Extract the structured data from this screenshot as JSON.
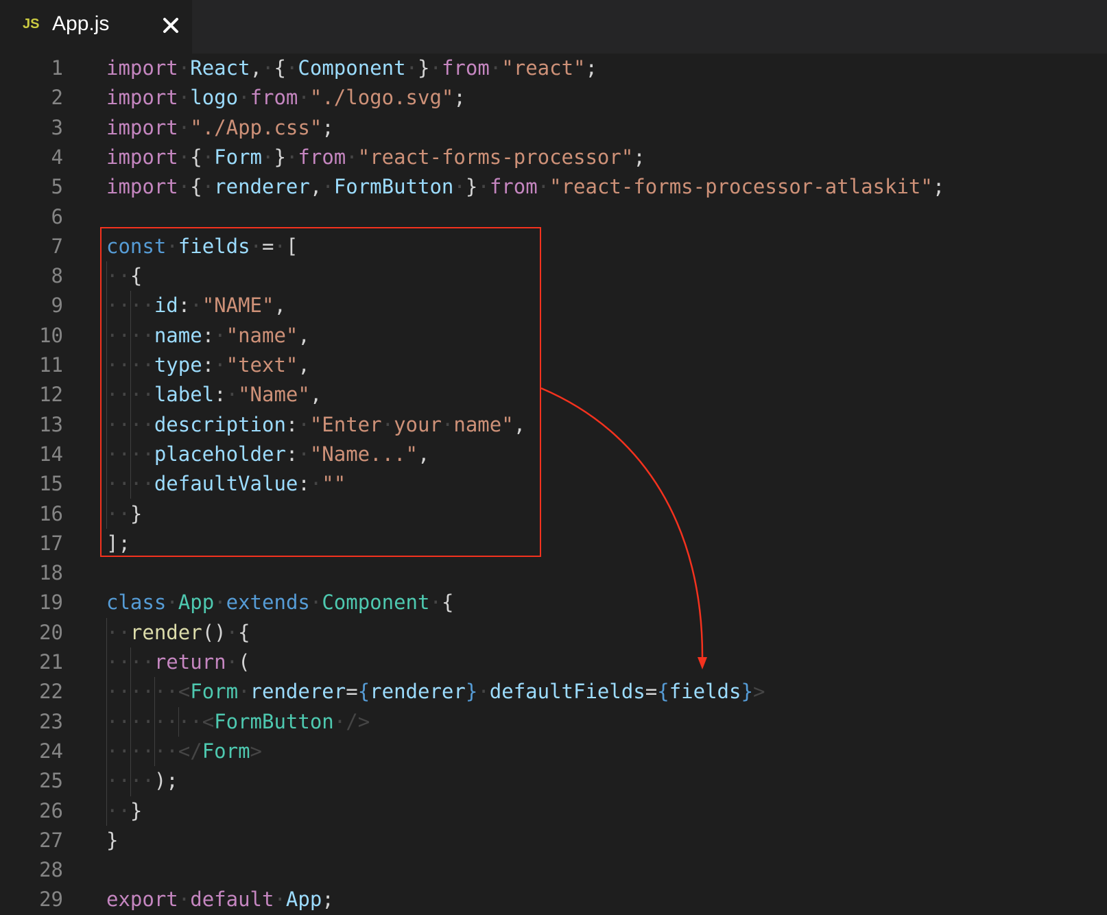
{
  "tab": {
    "icon_text": "JS",
    "filename": "App.js"
  },
  "lines": [
    {
      "n": "1",
      "tokens": [
        [
          "kw",
          "import"
        ],
        [
          "ws",
          "·"
        ],
        [
          "vr",
          "React"
        ],
        [
          "pl",
          ","
        ],
        [
          "ws",
          "·"
        ],
        [
          "pl",
          "{"
        ],
        [
          "ws",
          "·"
        ],
        [
          "vr",
          "Component"
        ],
        [
          "ws",
          "·"
        ],
        [
          "pl",
          "}"
        ],
        [
          "ws",
          "·"
        ],
        [
          "kw",
          "from"
        ],
        [
          "ws",
          "·"
        ],
        [
          "st",
          "\"react\""
        ],
        [
          "pl",
          ";"
        ]
      ]
    },
    {
      "n": "2",
      "tokens": [
        [
          "kw",
          "import"
        ],
        [
          "ws",
          "·"
        ],
        [
          "vr",
          "logo"
        ],
        [
          "ws",
          "·"
        ],
        [
          "kw",
          "from"
        ],
        [
          "ws",
          "·"
        ],
        [
          "st",
          "\"./logo.svg\""
        ],
        [
          "pl",
          ";"
        ]
      ]
    },
    {
      "n": "3",
      "tokens": [
        [
          "kw",
          "import"
        ],
        [
          "ws",
          "·"
        ],
        [
          "st",
          "\"./App.css\""
        ],
        [
          "pl",
          ";"
        ]
      ]
    },
    {
      "n": "4",
      "tokens": [
        [
          "kw",
          "import"
        ],
        [
          "ws",
          "·"
        ],
        [
          "pl",
          "{"
        ],
        [
          "ws",
          "·"
        ],
        [
          "vr",
          "Form"
        ],
        [
          "ws",
          "·"
        ],
        [
          "pl",
          "}"
        ],
        [
          "ws",
          "·"
        ],
        [
          "kw",
          "from"
        ],
        [
          "ws",
          "·"
        ],
        [
          "st",
          "\"react-forms-processor\""
        ],
        [
          "pl",
          ";"
        ]
      ]
    },
    {
      "n": "5",
      "tokens": [
        [
          "kw",
          "import"
        ],
        [
          "ws",
          "·"
        ],
        [
          "pl",
          "{"
        ],
        [
          "ws",
          "·"
        ],
        [
          "vr",
          "renderer"
        ],
        [
          "pl",
          ","
        ],
        [
          "ws",
          "·"
        ],
        [
          "vr",
          "FormButton"
        ],
        [
          "ws",
          "·"
        ],
        [
          "pl",
          "}"
        ],
        [
          "ws",
          "·"
        ],
        [
          "kw",
          "from"
        ],
        [
          "ws",
          "·"
        ],
        [
          "st",
          "\"react-forms-processor-atlaskit\""
        ],
        [
          "pl",
          ";"
        ]
      ]
    },
    {
      "n": "6",
      "tokens": []
    },
    {
      "n": "7",
      "tokens": [
        [
          "bl",
          "const"
        ],
        [
          "ws",
          "·"
        ],
        [
          "vr",
          "fields"
        ],
        [
          "ws",
          "·"
        ],
        [
          "pl",
          "="
        ],
        [
          "ws",
          "·"
        ],
        [
          "pl",
          "["
        ]
      ]
    },
    {
      "n": "8",
      "tokens": [
        [
          "ws",
          "··"
        ],
        [
          "pl",
          "{"
        ]
      ]
    },
    {
      "n": "9",
      "tokens": [
        [
          "ws",
          "····"
        ],
        [
          "vr",
          "id"
        ],
        [
          "pl",
          ":"
        ],
        [
          "ws",
          "·"
        ],
        [
          "st",
          "\"NAME\""
        ],
        [
          "pl",
          ","
        ]
      ]
    },
    {
      "n": "10",
      "tokens": [
        [
          "ws",
          "····"
        ],
        [
          "vr",
          "name"
        ],
        [
          "pl",
          ":"
        ],
        [
          "ws",
          "·"
        ],
        [
          "st",
          "\"name\""
        ],
        [
          "pl",
          ","
        ]
      ]
    },
    {
      "n": "11",
      "tokens": [
        [
          "ws",
          "····"
        ],
        [
          "vr",
          "type"
        ],
        [
          "pl",
          ":"
        ],
        [
          "ws",
          "·"
        ],
        [
          "st",
          "\"text\""
        ],
        [
          "pl",
          ","
        ]
      ]
    },
    {
      "n": "12",
      "tokens": [
        [
          "ws",
          "····"
        ],
        [
          "vr",
          "label"
        ],
        [
          "pl",
          ":"
        ],
        [
          "ws",
          "·"
        ],
        [
          "st",
          "\"Name\""
        ],
        [
          "pl",
          ","
        ]
      ]
    },
    {
      "n": "13",
      "tokens": [
        [
          "ws",
          "····"
        ],
        [
          "vr",
          "description"
        ],
        [
          "pl",
          ":"
        ],
        [
          "ws",
          "·"
        ],
        [
          "st",
          "\"Enter"
        ],
        [
          "ws",
          "·"
        ],
        [
          "st",
          "your"
        ],
        [
          "ws",
          "·"
        ],
        [
          "st",
          "name\""
        ],
        [
          "pl",
          ","
        ]
      ]
    },
    {
      "n": "14",
      "tokens": [
        [
          "ws",
          "····"
        ],
        [
          "vr",
          "placeholder"
        ],
        [
          "pl",
          ":"
        ],
        [
          "ws",
          "·"
        ],
        [
          "st",
          "\"Name...\""
        ],
        [
          "pl",
          ","
        ]
      ]
    },
    {
      "n": "15",
      "tokens": [
        [
          "ws",
          "····"
        ],
        [
          "vr",
          "defaultValue"
        ],
        [
          "pl",
          ":"
        ],
        [
          "ws",
          "·"
        ],
        [
          "st",
          "\"\""
        ]
      ]
    },
    {
      "n": "16",
      "tokens": [
        [
          "ws",
          "··"
        ],
        [
          "pl",
          "}"
        ]
      ]
    },
    {
      "n": "17",
      "tokens": [
        [
          "pl",
          "];"
        ]
      ]
    },
    {
      "n": "18",
      "tokens": []
    },
    {
      "n": "19",
      "tokens": [
        [
          "bl",
          "class"
        ],
        [
          "ws",
          "·"
        ],
        [
          "tp",
          "App"
        ],
        [
          "ws",
          "·"
        ],
        [
          "bl",
          "extends"
        ],
        [
          "ws",
          "·"
        ],
        [
          "tp",
          "Component"
        ],
        [
          "ws",
          "·"
        ],
        [
          "pl",
          "{"
        ]
      ]
    },
    {
      "n": "20",
      "tokens": [
        [
          "ws",
          "··"
        ],
        [
          "fn",
          "render"
        ],
        [
          "pl",
          "()"
        ],
        [
          "ws",
          "·"
        ],
        [
          "pl",
          "{"
        ]
      ]
    },
    {
      "n": "21",
      "tokens": [
        [
          "ws",
          "····"
        ],
        [
          "kw",
          "return"
        ],
        [
          "ws",
          "·"
        ],
        [
          "pl",
          "("
        ]
      ]
    },
    {
      "n": "22",
      "tokens": [
        [
          "ws",
          "······"
        ],
        [
          "ws",
          "<"
        ],
        [
          "tp",
          "Form"
        ],
        [
          "ws",
          "·"
        ],
        [
          "vr",
          "renderer"
        ],
        [
          "pl",
          "="
        ],
        [
          "bl",
          "{"
        ],
        [
          "vr",
          "renderer"
        ],
        [
          "bl",
          "}"
        ],
        [
          "ws",
          "·"
        ],
        [
          "vr",
          "defaultFields"
        ],
        [
          "pl",
          "="
        ],
        [
          "bl",
          "{"
        ],
        [
          "vr",
          "fields"
        ],
        [
          "bl",
          "}"
        ],
        [
          "ws",
          ">"
        ]
      ]
    },
    {
      "n": "23",
      "tokens": [
        [
          "ws",
          "········"
        ],
        [
          "ws",
          "<"
        ],
        [
          "tp",
          "FormButton"
        ],
        [
          "ws",
          "·"
        ],
        [
          "ws",
          "/>"
        ]
      ]
    },
    {
      "n": "24",
      "tokens": [
        [
          "ws",
          "······"
        ],
        [
          "ws",
          "</"
        ],
        [
          "tp",
          "Form"
        ],
        [
          "ws",
          ">"
        ]
      ]
    },
    {
      "n": "25",
      "tokens": [
        [
          "ws",
          "····"
        ],
        [
          "pl",
          ");"
        ]
      ]
    },
    {
      "n": "26",
      "tokens": [
        [
          "ws",
          "··"
        ],
        [
          "pl",
          "}"
        ]
      ]
    },
    {
      "n": "27",
      "tokens": [
        [
          "pl",
          "}"
        ]
      ]
    },
    {
      "n": "28",
      "tokens": []
    },
    {
      "n": "29",
      "tokens": [
        [
          "kw",
          "export"
        ],
        [
          "ws",
          "·"
        ],
        [
          "kw",
          "default"
        ],
        [
          "ws",
          "·"
        ],
        [
          "vr",
          "App"
        ],
        [
          "pl",
          ";"
        ]
      ]
    }
  ],
  "colors": {
    "keyword": "#c586c0",
    "string": "#ce9178",
    "variable": "#9cdcfe",
    "storage": "#569cd6",
    "type": "#4ec9b0",
    "function": "#dcdcaa",
    "annotation": "#f4321e"
  }
}
